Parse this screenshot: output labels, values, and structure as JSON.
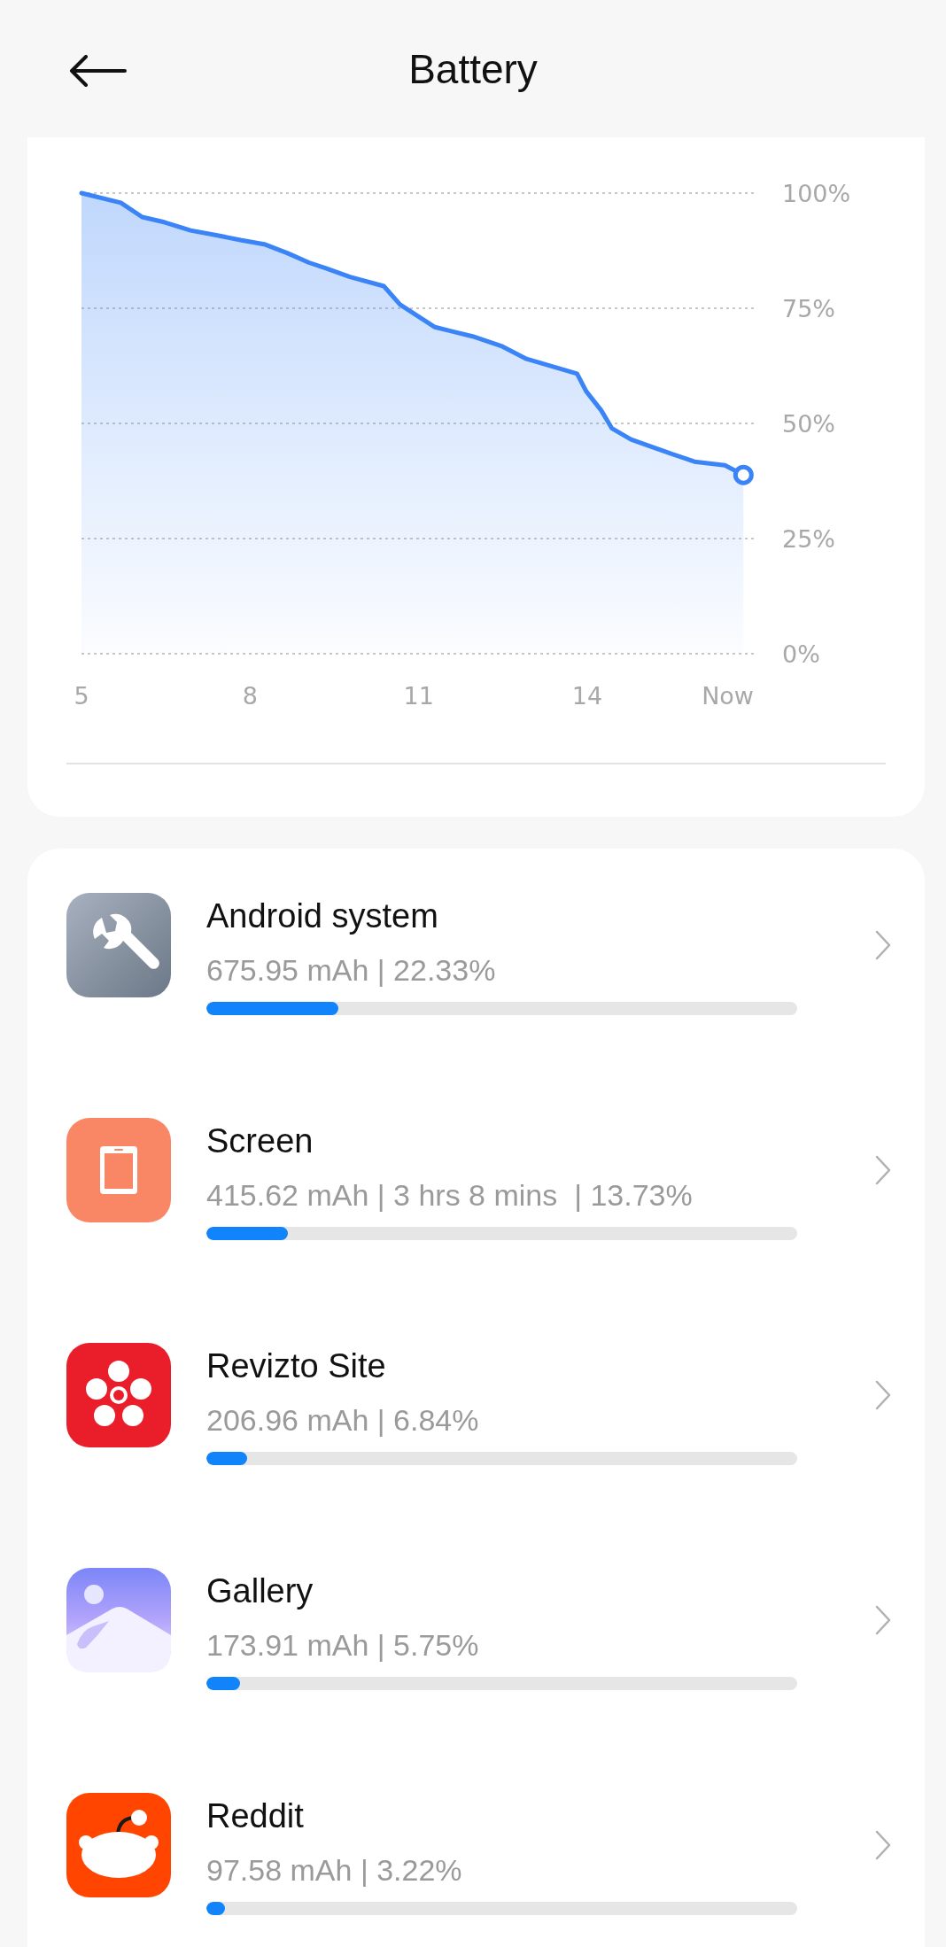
{
  "header": {
    "title": "Battery"
  },
  "battery_chart": {
    "chart_data": {
      "type": "area",
      "x": [
        5,
        5.7,
        6.08,
        6.47,
        6.94,
        7.42,
        7.83,
        8.25,
        8.66,
        9.05,
        9.35,
        9.78,
        10.38,
        10.67,
        11.29,
        11.96,
        12.47,
        12.92,
        13.82,
        13.98,
        14.25,
        14.44,
        14.78,
        15.38,
        15.91,
        16.45,
        16.78
      ],
      "series": [
        {
          "color": "#3a84f7",
          "values": [
            100,
            97.9,
            94.8,
            93.7,
            91.9,
            90.8,
            89.8,
            88.9,
            87,
            84.9,
            83.7,
            81.8,
            79.8,
            75.8,
            70.9,
            68.9,
            66.8,
            64,
            60.8,
            57,
            52.8,
            48.9,
            46.5,
            43.9,
            41.7,
            40.9,
            38.8
          ]
        }
      ],
      "xlim": [
        5,
        16.98
      ],
      "ylim": [
        0,
        100
      ],
      "grid": true,
      "xticks": [
        5,
        8,
        11,
        14,
        {
          "value": 16.5,
          "label": "Now"
        }
      ],
      "yticks": [
        {
          "value": 0,
          "label": "0%"
        },
        {
          "value": 25,
          "label": "25%"
        },
        {
          "value": 50,
          "label": "50%"
        },
        {
          "value": 75,
          "label": "75%"
        },
        {
          "value": 100,
          "label": "100%"
        }
      ]
    }
  },
  "apps": [
    {
      "kind": "wrench",
      "name": "Android system",
      "detail": "675.95 mAh | 22.33%",
      "level": 0.2233
    },
    {
      "kind": "screen",
      "name": "Screen",
      "detail": "415.62 mAh | 3 hrs 8 mins  | 13.73%",
      "level": 0.1373
    },
    {
      "kind": "revizto",
      "name": "Revizto Site",
      "detail": "206.96 mAh | 6.84%",
      "level": 0.0684
    },
    {
      "kind": "gallery",
      "name": "Gallery",
      "detail": "173.91 mAh | 5.75%",
      "level": 0.0575
    },
    {
      "kind": "reddit",
      "name": "Reddit",
      "detail": "97.58 mAh | 3.22%",
      "level": 0.0322
    }
  ]
}
